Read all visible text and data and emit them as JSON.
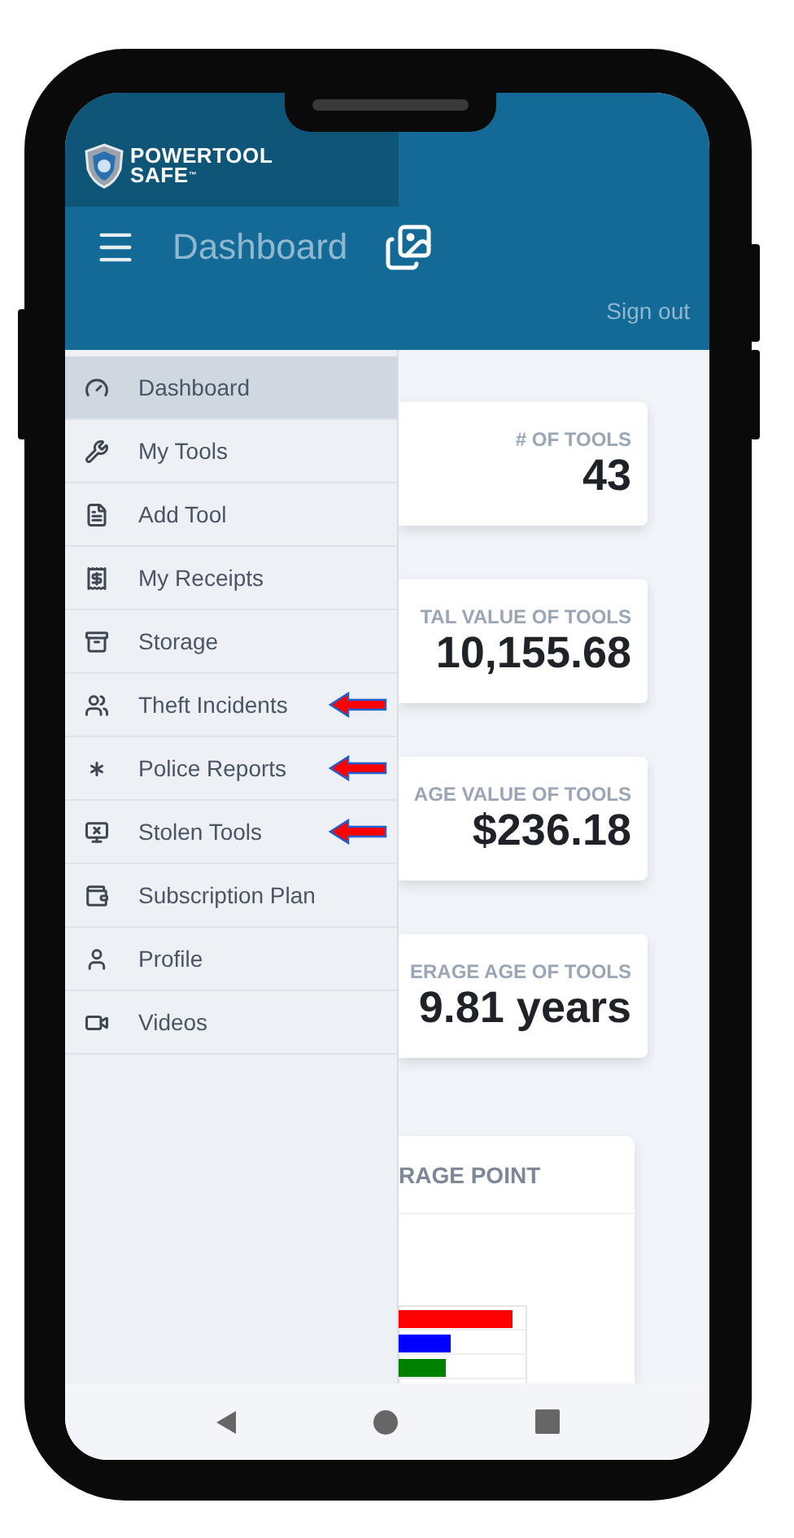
{
  "logo": {
    "line1": "POWERTOOL",
    "line2": "SAFE",
    "mark": "™"
  },
  "toolbar": {
    "title": "Dashboard"
  },
  "sign_out": "Sign out",
  "drawer": {
    "items": [
      {
        "label": "Dashboard",
        "selected": true,
        "flagged": false
      },
      {
        "label": "My Tools",
        "selected": false,
        "flagged": false
      },
      {
        "label": "Add Tool",
        "selected": false,
        "flagged": false
      },
      {
        "label": "My Receipts",
        "selected": false,
        "flagged": false
      },
      {
        "label": "Storage",
        "selected": false,
        "flagged": false
      },
      {
        "label": "Theft Incidents",
        "selected": false,
        "flagged": true
      },
      {
        "label": "Police Reports",
        "selected": false,
        "flagged": true
      },
      {
        "label": "Stolen Tools",
        "selected": false,
        "flagged": true
      },
      {
        "label": "Subscription Plan",
        "selected": false,
        "flagged": false
      },
      {
        "label": "Profile",
        "selected": false,
        "flagged": false
      },
      {
        "label": "Videos",
        "selected": false,
        "flagged": false
      }
    ]
  },
  "stats": [
    {
      "label": "# OF TOOLS",
      "value": "43"
    },
    {
      "label": "TAL VALUE OF TOOLS",
      "value": "10,155.68"
    },
    {
      "label": "AGE VALUE OF TOOLS",
      "value": "$236.18"
    },
    {
      "label": "ERAGE AGE OF TOOLS",
      "value": "9.81 years"
    }
  ],
  "chart_card": {
    "title": "RAGE POINT"
  }
}
